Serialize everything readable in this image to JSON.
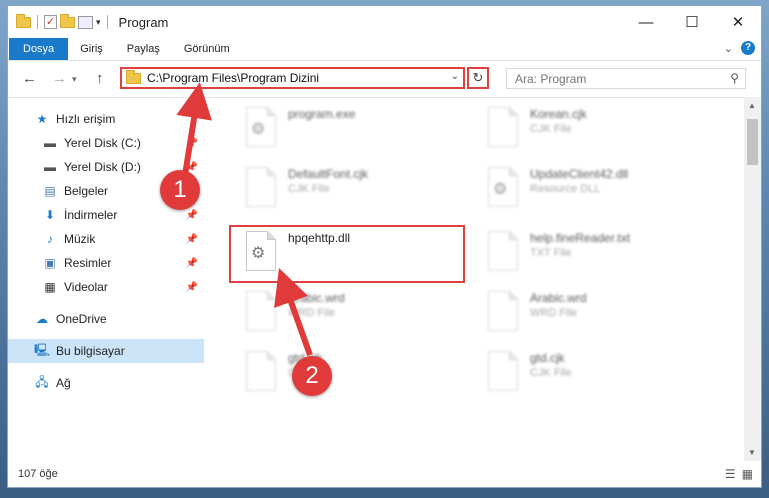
{
  "window": {
    "title": "Program",
    "controls": {
      "minimize": "—",
      "maximize": "☐",
      "close": "✕"
    }
  },
  "ribbon": {
    "tabs": [
      "Dosya",
      "Giriş",
      "Paylaş",
      "Görünüm"
    ],
    "help": "?"
  },
  "navigation": {
    "back": "←",
    "forward": "→",
    "up": "↑",
    "address": "C:\\Program Files\\Program Dizini",
    "refresh": "↻",
    "search_placeholder": "Ara: Program"
  },
  "sidebar": {
    "items": [
      {
        "label": "Hızlı erişim",
        "icon": "star-icon"
      },
      {
        "label": "Yerel Disk (C:)",
        "icon": "drive-icon",
        "pinned": true
      },
      {
        "label": "Yerel Disk (D:)",
        "icon": "drive-icon",
        "pinned": true
      },
      {
        "label": "Belgeler",
        "icon": "document-icon",
        "pinned": true
      },
      {
        "label": "İndirmeler",
        "icon": "download-icon",
        "pinned": true
      },
      {
        "label": "Müzik",
        "icon": "music-icon",
        "pinned": true
      },
      {
        "label": "Resimler",
        "icon": "picture-icon",
        "pinned": true
      },
      {
        "label": "Videolar",
        "icon": "video-icon",
        "pinned": true
      },
      {
        "label": "OneDrive",
        "icon": "cloud-icon"
      },
      {
        "label": "Bu bilgisayar",
        "icon": "computer-icon",
        "selected": true
      },
      {
        "label": "Ağ",
        "icon": "network-icon"
      }
    ]
  },
  "files": [
    {
      "name": "program.exe",
      "type": ""
    },
    {
      "name": "Korean.cjk",
      "type": "CJK File"
    },
    {
      "name": "DefaultFont.cjk",
      "type": "CJK File"
    },
    {
      "name": "UpdateClient42.dll",
      "type": "Resource DLL"
    },
    {
      "name": "hpqehttp.dll",
      "type": ""
    },
    {
      "name": "help.fineReader.txt",
      "type": "TXT File"
    },
    {
      "name": "Arabic.wrd",
      "type": "WRD File"
    },
    {
      "name": "Arabic.wrd",
      "type": "WRD File"
    },
    {
      "name": "gtd.cjk",
      "type": "CJK File"
    },
    {
      "name": "gtd.cjk",
      "type": "CJK File"
    }
  ],
  "status": {
    "count": "107 öğe"
  },
  "callouts": {
    "one": "1",
    "two": "2"
  },
  "colors": {
    "accent": "#1979ca",
    "highlight": "#e04040",
    "selection": "#cce4f7"
  }
}
